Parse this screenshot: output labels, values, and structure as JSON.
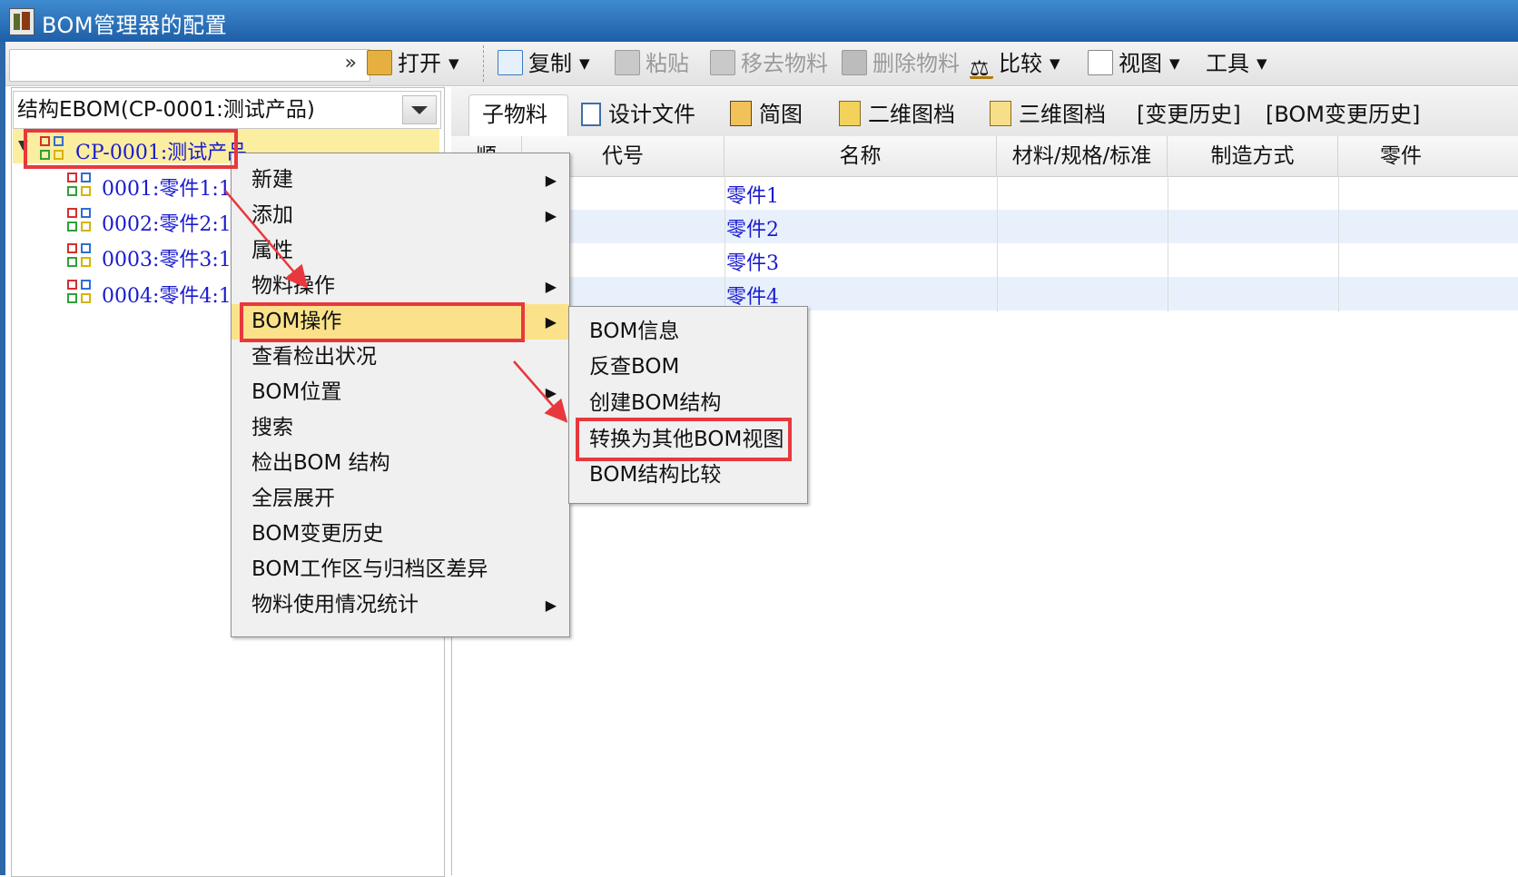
{
  "window": {
    "title": "BOM管理器的配置"
  },
  "toolbar": {
    "combo_value": "",
    "open": "打开",
    "copy": "复制",
    "paste": "粘贴",
    "remove_material": "移去物料",
    "delete_material": "删除物料",
    "compare": "比较",
    "view": "视图",
    "tools": "工具"
  },
  "left": {
    "view_selector": "结构EBOM(CP-0001:测试产品)",
    "tree": {
      "root": "CP-0001:测试产品",
      "children": [
        "0001:零件1:1",
        "0002:零件2:1",
        "0003:零件3:1",
        "0004:零件4:1"
      ]
    }
  },
  "tabs": [
    "子物料",
    "设计文件",
    "简图",
    "二维图档",
    "三维图档",
    "[变更历史]",
    "[BOM变更历史]"
  ],
  "grid": {
    "columns": [
      "顺",
      "代号",
      "名称",
      "材料/规格/标准",
      "制造方式",
      "零件"
    ],
    "rows": [
      {
        "name": "零件1"
      },
      {
        "name": "零件2"
      },
      {
        "name": "零件3"
      },
      {
        "name": "零件4"
      }
    ]
  },
  "context_menu": {
    "items": [
      "新建",
      "添加",
      "属性",
      "物料操作",
      "BOM操作",
      "查看检出状况",
      "BOM位置",
      "搜索",
      "检出BOM 结构",
      "全层展开",
      "BOM变更历史",
      "BOM工作区与归档区差异",
      "物料使用情况统计"
    ],
    "highlighted": "BOM操作"
  },
  "submenu": {
    "items": [
      "BOM信息",
      "反查BOM",
      "创建BOM结构",
      "转换为其他BOM视图",
      "BOM结构比较"
    ],
    "target": "转换为其他BOM视图"
  },
  "colors": {
    "title_bar": "#2a6cb8",
    "highlight": "#fbe28a",
    "annotation_red": "#e8383d",
    "link_blue": "#1a1ad0"
  }
}
